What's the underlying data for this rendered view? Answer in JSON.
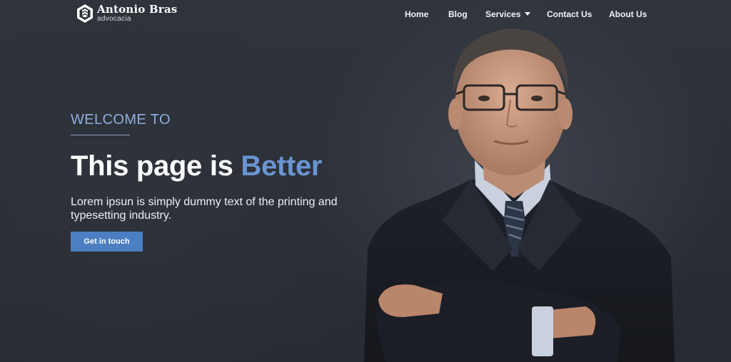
{
  "brand": {
    "name": "Antonio Bras",
    "subtitle": "advocacia",
    "logo_icon": "hexagon-logo-icon"
  },
  "nav": {
    "items": [
      {
        "label": "Home"
      },
      {
        "label": "Blog"
      },
      {
        "label": "Services",
        "has_dropdown": true,
        "dropdown_icon": "caret-down-icon"
      },
      {
        "label": "Contact Us"
      },
      {
        "label": "About Us"
      }
    ]
  },
  "hero": {
    "eyebrow": "WELCOME TO",
    "headline_main": "This page is ",
    "headline_accent": "Better",
    "lead": "Lorem ipsun is simply dummy text of the printing and typesetting industry.",
    "cta_label": "Get in touch",
    "image": "businessman-portrait"
  },
  "colors": {
    "background": "#2b2f37",
    "accent": "#6a95d0",
    "eyebrow": "#8fb0dd",
    "button": "#4c7fc1",
    "text": "#ffffff"
  }
}
